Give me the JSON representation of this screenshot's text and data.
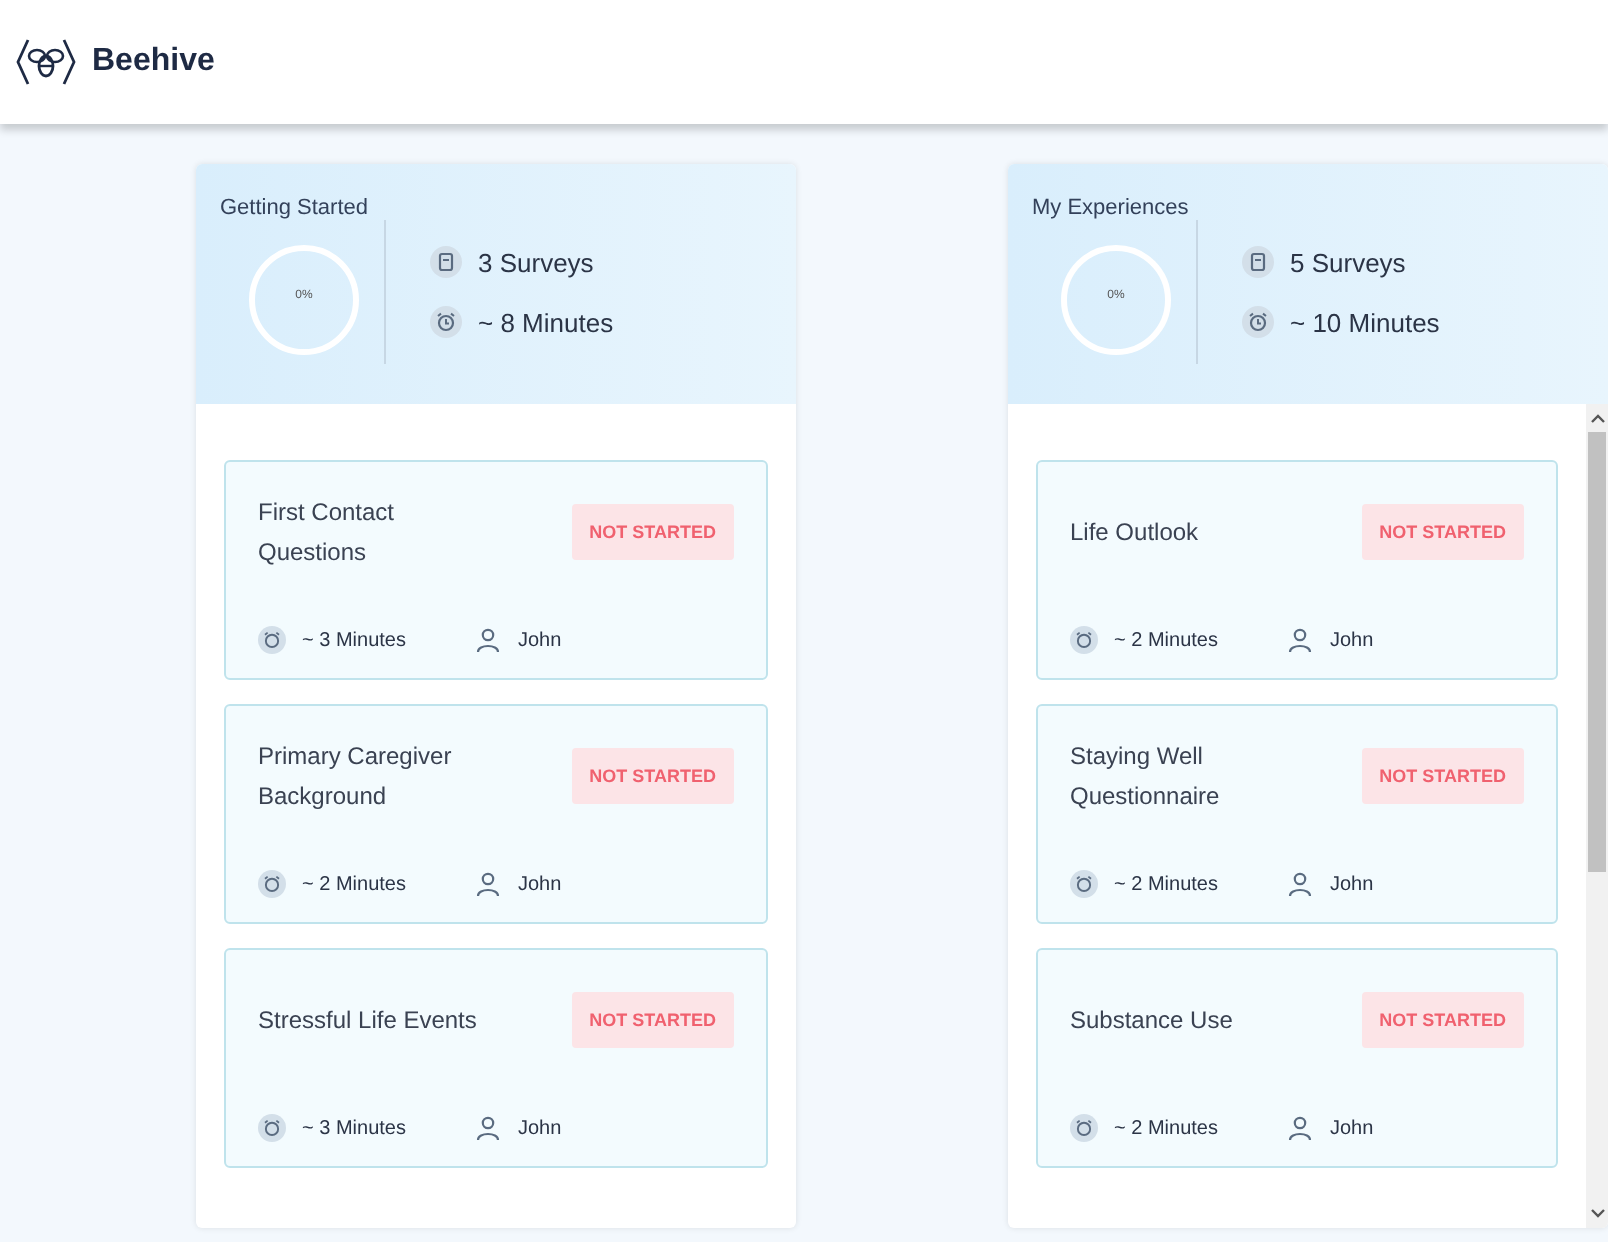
{
  "app": {
    "name": "Beehive"
  },
  "columns": [
    {
      "title": "Getting Started",
      "progress": "0%",
      "level": 0,
      "surveys": "3 Surveys",
      "duration": "~ 8 Minutes",
      "scrollbar": false,
      "items": [
        {
          "title": "First Contact Questions",
          "status": "NOT STARTED",
          "kind": "not_started",
          "time": "~ 3 Minutes",
          "person": "John"
        },
        {
          "title": "Primary Caregiver Background",
          "status": "NOT STARTED",
          "kind": "not_started",
          "time": "~ 2 Minutes",
          "person": "John"
        },
        {
          "title": "Stressful Life Events",
          "status": "NOT STARTED",
          "kind": "not_started",
          "time": "~ 3 Minutes",
          "person": "John"
        }
      ]
    },
    {
      "title": "My Experiences",
      "progress": "0%",
      "level": 0,
      "surveys": "5 Surveys",
      "duration": "~ 10 Minutes",
      "scrollbar": true,
      "items": [
        {
          "title": "Life Outlook",
          "status": "NOT STARTED",
          "kind": "not_started",
          "time": "~ 2 Minutes",
          "person": "John"
        },
        {
          "title": "Staying Well Questionnaire",
          "status": "NOT STARTED",
          "kind": "not_started",
          "time": "~ 2 Minutes",
          "person": "John"
        },
        {
          "title": "Substance Use",
          "status": "NOT STARTED",
          "kind": "not_started",
          "time": "~ 2 Minutes",
          "person": "John"
        }
      ]
    }
  ]
}
